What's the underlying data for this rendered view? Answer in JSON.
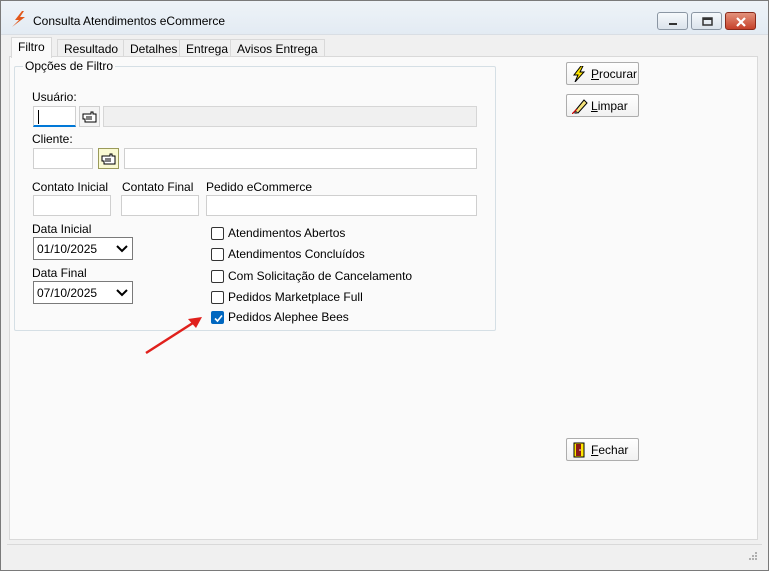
{
  "window": {
    "title": "Consulta Atendimentos eCommerce",
    "title_icon": "lightning-logo-icon",
    "controls": [
      "minimize-icon",
      "maximize-icon",
      "close-icon"
    ]
  },
  "tabs": [
    {
      "label": "Filtro",
      "active": true
    },
    {
      "label": "Resultado"
    },
    {
      "label": "Detalhes"
    },
    {
      "label": "Entrega"
    },
    {
      "label": "Avisos Entrega"
    }
  ],
  "filter": {
    "group_title": "Opções de Filtro",
    "usuario_label": "Usuário:",
    "usuario_value": "",
    "usuario_desc": "",
    "cliente_label": "Cliente:",
    "cliente_value": "",
    "cliente_desc": "",
    "contato_inicial_label": "Contato Inicial",
    "contato_inicial_value": "",
    "contato_final_label": "Contato Final",
    "contato_final_value": "",
    "pedido_label": "Pedido eCommerce",
    "pedido_value": "",
    "data_inicial_label": "Data Inicial",
    "data_inicial_value": "01/10/2025",
    "data_final_label": "Data Final",
    "data_final_value": "07/10/2025"
  },
  "checkboxes": [
    {
      "label": "Atendimentos Abertos",
      "checked": false
    },
    {
      "label": "Atendimentos Concluídos",
      "checked": false
    },
    {
      "label": "Com Solicitação de Cancelamento",
      "checked": false
    },
    {
      "label": "Pedidos Marketplace Full",
      "checked": false
    },
    {
      "label": "Pedidos Alephee Bees",
      "checked": true
    }
  ],
  "buttons": {
    "procurar": {
      "label_first": "P",
      "label_rest": "rocurar",
      "icon": "lightning-icon"
    },
    "limpar": {
      "label_first": "L",
      "label_rest": "impar",
      "icon": "eraser-icon"
    },
    "fechar": {
      "label_first": "F",
      "label_rest": "echar",
      "icon": "exit-door-icon"
    }
  },
  "colors": {
    "checkbox_accent": "#0067c0",
    "focus_underline": "#0078d7",
    "annotation_arrow": "#e0201c"
  }
}
